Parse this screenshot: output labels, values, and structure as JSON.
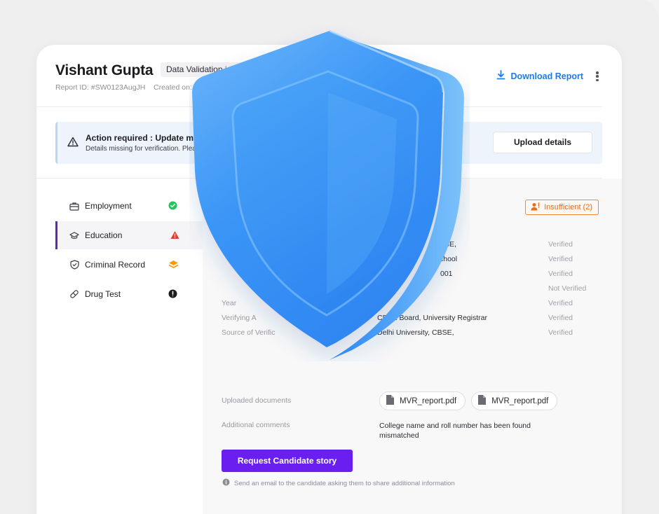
{
  "header": {
    "candidate_name": "Vishant Gupta",
    "report_type": "Data Validation in P",
    "report_id": "Report ID: #SW0123AugJH",
    "created_on": "Created on: 30",
    "download_label": "Download Report"
  },
  "alert": {
    "title": "Action required : Update miss",
    "description": "Details missing for verification. Plea",
    "upload_label": "Upload details"
  },
  "sidebar": {
    "items": [
      {
        "label": "Employment",
        "icon": "briefcase-icon",
        "status": "verified"
      },
      {
        "label": "Education",
        "icon": "graduation-cap-icon",
        "status": "warning"
      },
      {
        "label": "Criminal Record",
        "icon": "shield-check-icon",
        "status": "layers"
      },
      {
        "label": "Drug Test",
        "icon": "pill-icon",
        "status": "alert"
      }
    ]
  },
  "main": {
    "insufficient_label": "Insufficient (2)",
    "rows": [
      {
        "label": "",
        "value": "SE,",
        "status": "Verified"
      },
      {
        "label": "",
        "value": "chool",
        "status": "Verified"
      },
      {
        "label": "",
        "value": "001",
        "status": "Verified"
      },
      {
        "label": "",
        "value": "",
        "status": "Not Verified"
      },
      {
        "label": "Year",
        "value": "",
        "status": "Verified"
      },
      {
        "label": "Verifying A",
        "value": "CBSE Board, University Registrar",
        "status": "Verified"
      },
      {
        "label": "Source of Verific",
        "value": "Delhi University, CBSE,",
        "status": "Verified"
      }
    ],
    "uploaded_label": "Uploaded documents",
    "documents": [
      "MVR_report.pdf",
      "MVR_report.pdf"
    ],
    "comments_label": "Additional comments",
    "comments_value": "College name and roll number has been found mismatched",
    "request_button": "Request Candidate story",
    "request_note": "Send an email to the candidate asking them to share additional information"
  },
  "colors": {
    "accent_purple": "#6a1ff0",
    "link_blue": "#1e7ce8",
    "warning_orange": "#ef8a3a",
    "verified_green": "#22c55e",
    "shield_blue": "#2f8df5"
  }
}
